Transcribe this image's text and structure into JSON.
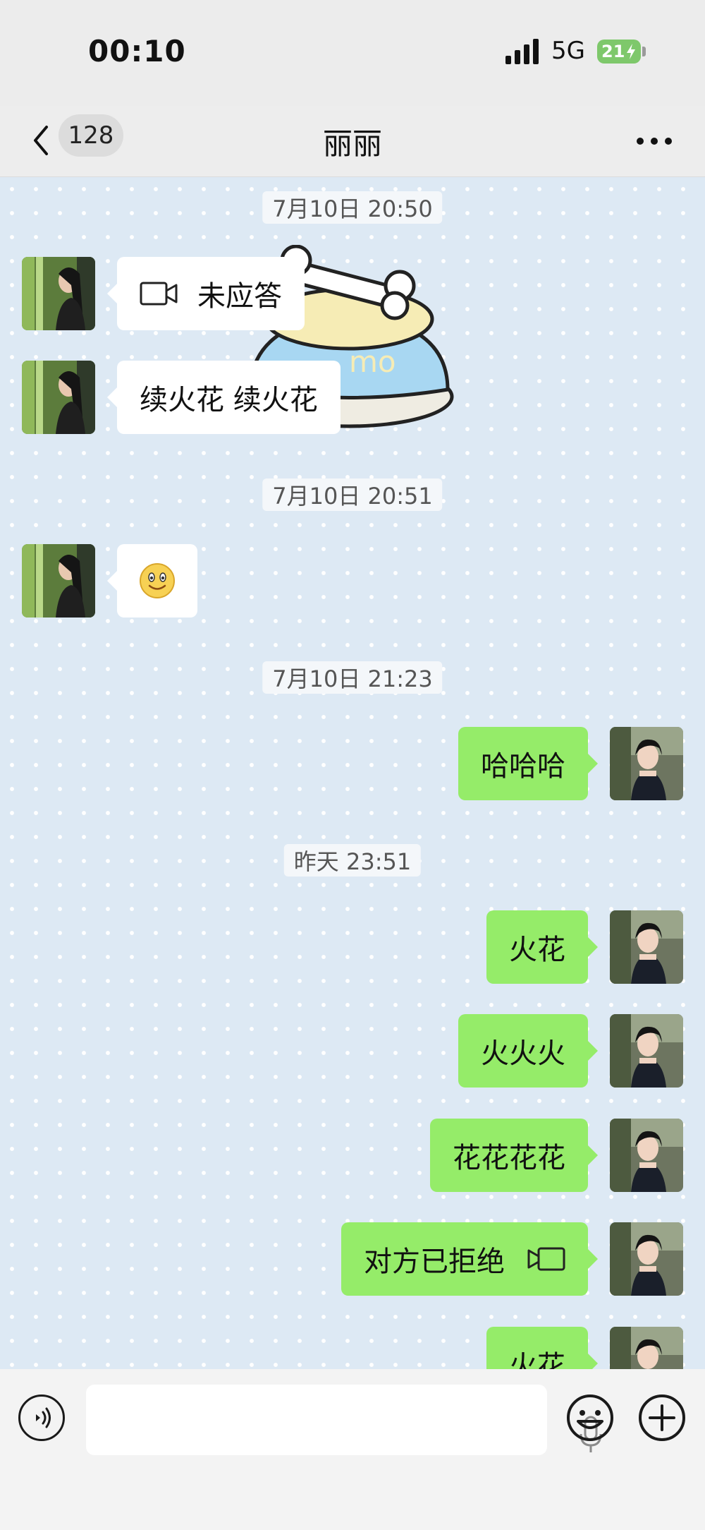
{
  "status_bar": {
    "time": "00:10",
    "network": "5G",
    "battery": "21"
  },
  "header": {
    "unread_count": "128",
    "title": "丽丽"
  },
  "colors": {
    "outgoing_bubble": "#95ec69",
    "incoming_bubble": "#ffffff",
    "chat_bg": "#dde9f4"
  },
  "messages": [
    {
      "type": "timestamp",
      "text": "7月10日 20:50"
    },
    {
      "type": "incoming",
      "kind": "call",
      "icon": "video-call-icon",
      "text": "未应答"
    },
    {
      "type": "incoming",
      "kind": "text",
      "text": "续火花 续火花"
    },
    {
      "type": "timestamp",
      "text": "7月10日 20:51"
    },
    {
      "type": "incoming",
      "kind": "emoji",
      "icon": "smile-emoji-icon"
    },
    {
      "type": "timestamp",
      "text": "7月10日 21:23"
    },
    {
      "type": "outgoing",
      "kind": "text",
      "text": "哈哈哈"
    },
    {
      "type": "timestamp",
      "text": "昨天 23:51"
    },
    {
      "type": "outgoing",
      "kind": "text",
      "text": "火花"
    },
    {
      "type": "outgoing",
      "kind": "text",
      "text": "火火火"
    },
    {
      "type": "outgoing",
      "kind": "text",
      "text": "花花花花"
    },
    {
      "type": "outgoing",
      "kind": "call",
      "icon": "video-call-icon",
      "text": "对方已拒绝"
    },
    {
      "type": "outgoing",
      "kind": "text",
      "text": "火花"
    }
  ],
  "sticker": {
    "text": "mo"
  }
}
